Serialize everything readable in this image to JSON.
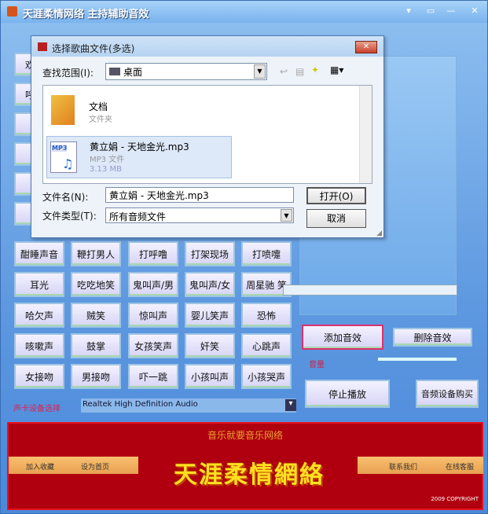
{
  "window": {
    "title": "天涯柔情网络  主持辅助音效",
    "min": "▾",
    "restore": "▭",
    "max": "—",
    "close": "✕"
  },
  "left_column": [
    "欢",
    "呼",
    "",
    "",
    "",
    ""
  ],
  "effects": [
    [
      "酣睡声音",
      "鞭打男人",
      "打呼噜",
      "打架现场",
      "打喷嚏"
    ],
    [
      "耳光",
      "吃吃地笑",
      "鬼叫声/男",
      "鬼叫声/女",
      "周星驰 笑"
    ],
    [
      "哈欠声",
      "贼笑",
      "惊叫声",
      "婴儿笑声",
      "恐怖"
    ],
    [
      "咳嗽声",
      "鼓掌",
      "女孩笑声",
      "奸笑",
      "心跳声"
    ],
    [
      "女接吻",
      "男接吻",
      "吓一跳",
      "小孩叫声",
      "小孩哭声"
    ]
  ],
  "right": {
    "add_effect": "添加音效",
    "delete_effect": "删除音效",
    "volume_label": "音量",
    "stop_play": "停止播放",
    "buy_device": "音频设备购买"
  },
  "bottom_row": {
    "label": "声卡设备选择",
    "device": "Realtek High Definition Audio",
    "arrow": "▾"
  },
  "banner": {
    "slogan": "音乐就要音乐网络",
    "logo": "天涯柔情網絡",
    "left_links": [
      "加入收藏",
      "设为首页"
    ],
    "right_links": [
      "联系我们",
      "在线客服"
    ],
    "copyright": "2009 COPYRIGHT"
  },
  "dialog": {
    "title": "选择歌曲文件(多选)",
    "close": "✕",
    "look_in_label": "查找范围(I):",
    "look_in_value": "桌面",
    "items": [
      {
        "name": "文档",
        "type": "文件夹"
      },
      {
        "name": "黄立娟 - 天地金光.mp3",
        "type": "MP3 文件",
        "size": "3.13 MB",
        "badge": "MP3"
      }
    ],
    "filename_label": "文件名(N):",
    "filename_value": "黄立娟 - 天地金光.mp3",
    "filetype_label": "文件类型(T):",
    "filetype_value": "所有音频文件",
    "open": "打开(O)",
    "cancel": "取消"
  },
  "colors": {
    "highlight": "#e0306a",
    "banner": "#b00010"
  }
}
